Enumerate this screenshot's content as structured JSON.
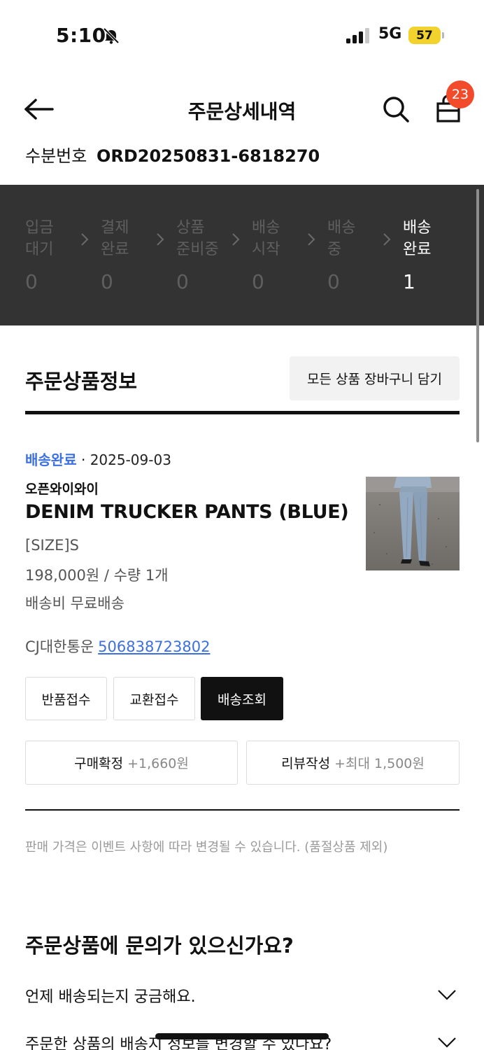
{
  "status_bar": {
    "time": "5:10",
    "network": "5G",
    "battery": "57",
    "icons": [
      "bell-slash-icon",
      "signal-icon",
      "battery-icon"
    ]
  },
  "header": {
    "title": "주문상세내역",
    "bag_count": "23",
    "icons": [
      "arrow-left-icon",
      "search-icon",
      "shopping-bag-icon"
    ]
  },
  "order": {
    "number_label": "수분번호",
    "number_value": "ORD20250831-6818270"
  },
  "progress": {
    "steps": [
      {
        "line1": "입금",
        "line2": "대기",
        "count": "0",
        "active": false
      },
      {
        "line1": "결제",
        "line2": "완료",
        "count": "0",
        "active": false
      },
      {
        "line1": "상품",
        "line2": "준비중",
        "count": "0",
        "active": false
      },
      {
        "line1": "배송",
        "line2": "시작",
        "count": "0",
        "active": false
      },
      {
        "line1": "배송",
        "line2": "중",
        "count": "0",
        "active": false
      },
      {
        "line1": "배송",
        "line2": "완료",
        "count": "1",
        "active": true
      }
    ]
  },
  "product_section": {
    "title": "주문상품정보",
    "cart_all_button": "모든 상품 장바구니 담기"
  },
  "item": {
    "status": "배송완료",
    "separator": "·",
    "date": "2025-09-03",
    "brand": "오픈와이와이",
    "name": "DENIM TRUCKER PANTS (BLUE)",
    "option": "[SIZE]S",
    "price_qty": "198,000원 / 수량 1개",
    "shipping": "배송비 무료배송",
    "courier": "CJ대한통운",
    "tracking_number": "506838723802",
    "status_color": "#3c6fe0"
  },
  "actions": {
    "return_label": "반품접수",
    "exchange_label": "교환접수",
    "track_label": "배송조회",
    "confirm_label": "구매확정",
    "confirm_points": "+1,660원",
    "review_label": "리뷰작성",
    "review_points": "+최대 1,500원"
  },
  "notice": "판매 가격은 이벤트 사항에 따라 변경될 수 있습니다. (품절상품 제외)",
  "faq": {
    "title": "주문상품에 문의가 있으신가요?",
    "items": [
      "언제 배송되는지 궁금해요.",
      "주문한 상품의 배송지 정보를 변경할 수 있나요?"
    ]
  }
}
